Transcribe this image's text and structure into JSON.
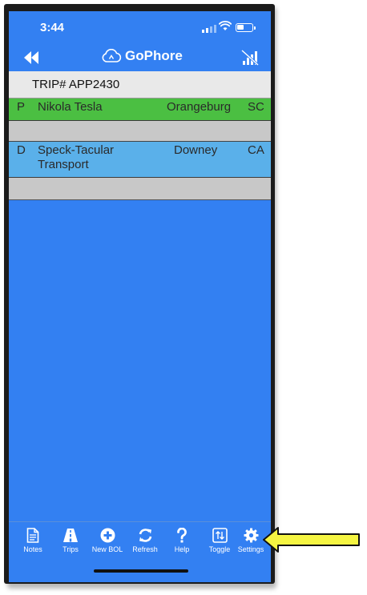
{
  "status_bar": {
    "time": "3:44"
  },
  "header": {
    "app_title": "GoPhore"
  },
  "trip": {
    "label": "TRIP# APP2430"
  },
  "stops": [
    {
      "type": "P",
      "name": "Nikola Tesla",
      "city": "Orangeburg",
      "state": "SC",
      "color": "#4bbf42"
    },
    {
      "type": "D",
      "name": "Speck-Tacular Transport",
      "city": "Downey",
      "state": "CA",
      "color": "#5ab0ea"
    }
  ],
  "toolbar": {
    "items": [
      {
        "label": "Notes",
        "icon": "document-icon"
      },
      {
        "label": "Trips",
        "icon": "road-icon"
      },
      {
        "label": "New BOL",
        "icon": "plus-circle-icon"
      },
      {
        "label": "Refresh",
        "icon": "refresh-icon"
      },
      {
        "label": "Help",
        "icon": "question-icon"
      },
      {
        "label": "Toggle",
        "icon": "toggle-icon"
      },
      {
        "label": "Settings",
        "icon": "gear-icon"
      }
    ]
  },
  "colors": {
    "background": "#3380f2",
    "annotation_arrow": "#f5f542"
  }
}
